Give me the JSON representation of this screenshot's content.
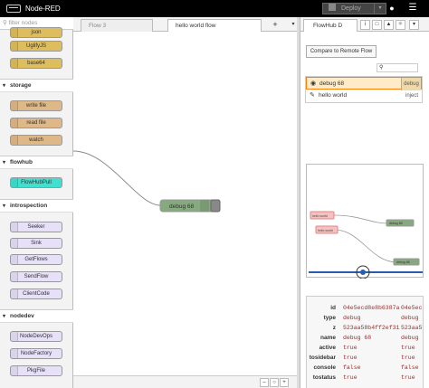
{
  "header": {
    "app_name": "Node-RED",
    "deploy_label": "Deploy"
  },
  "palette": {
    "filter_placeholder": "filter nodes",
    "categories": [
      {
        "label": "storage"
      },
      {
        "label": "flowhub"
      },
      {
        "label": "introspection"
      },
      {
        "label": "nodedev"
      }
    ],
    "nodes": [
      {
        "label": "json",
        "color": "#DEBD5C"
      },
      {
        "label": "UglifyJS",
        "color": "#DEBD5C"
      },
      {
        "label": "base64",
        "color": "#DEBD5C"
      },
      {
        "label": "write file",
        "color": "#DEB887"
      },
      {
        "label": "read file",
        "color": "#DEB887"
      },
      {
        "label": "watch",
        "color": "#DEB887"
      },
      {
        "label": "FlowHubPull",
        "color": "#40E0D0"
      },
      {
        "label": "Seeker",
        "color": "#E6E0F8"
      },
      {
        "label": "Sink",
        "color": "#E6E0F8"
      },
      {
        "label": "GetFlows",
        "color": "#E6E0F8"
      },
      {
        "label": "SendFlow",
        "color": "#E6E0F8"
      },
      {
        "label": "ClientCode",
        "color": "#E6E0F8"
      },
      {
        "label": "NodeDevOps",
        "color": "#E6E0F8"
      },
      {
        "label": "NodeFactory",
        "color": "#E6E0F8"
      },
      {
        "label": "PkgFile",
        "color": "#E6E0F8"
      }
    ]
  },
  "workspace": {
    "tabs": [
      {
        "label": "Flow 3"
      },
      {
        "label": "hello world flow"
      }
    ],
    "add_tab": "+",
    "tab_menu": "▾",
    "canvas_nodes": [
      {
        "label": "debug 68",
        "color": "#87A980"
      }
    ],
    "footer_buttons": [
      "–",
      "○",
      "+"
    ]
  },
  "sidebar": {
    "tab_label": "FlowHub D",
    "compare_button": "Compare to Remote Flow",
    "rows": [
      {
        "label": "debug 68",
        "type": "debug",
        "icon": "eye-icon"
      },
      {
        "label": "hello world",
        "type": "inject",
        "icon": "pencil-icon"
      }
    ],
    "preview_nodes": [
      {
        "label": "hello world",
        "color": "#f6c1c1"
      },
      {
        "label": "hello world",
        "color": "#f6c1c1"
      },
      {
        "label": "debug 68",
        "color": "#87A980"
      },
      {
        "label": "debug 68",
        "color": "#87A980"
      }
    ],
    "props": [
      {
        "key": "id",
        "v1": "04e5ecd8e8b6387a",
        "v2": "04e5ec"
      },
      {
        "key": "type",
        "v1": "debug",
        "v2": "debug"
      },
      {
        "key": "z",
        "v1": "523aa58b4ff2ef31",
        "v2": "523aa5"
      },
      {
        "key": "name",
        "v1": "debug 68",
        "v2": "debug"
      },
      {
        "key": "active",
        "v1": "true",
        "v2": "true"
      },
      {
        "key": "tosidebar",
        "v1": "true",
        "v2": "true"
      },
      {
        "key": "console",
        "v1": "false",
        "v2": "false"
      },
      {
        "key": "tostatus",
        "v1": "true",
        "v2": "true"
      }
    ]
  }
}
